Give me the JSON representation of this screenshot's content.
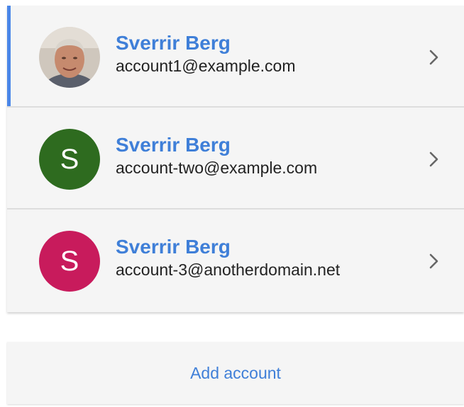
{
  "accounts": [
    {
      "name": "Sverrir Berg",
      "email": "account1@example.com",
      "avatar_type": "photo",
      "avatar_letter": "",
      "selected": true
    },
    {
      "name": "Sverrir Berg",
      "email": "account-two@example.com",
      "avatar_type": "letter",
      "avatar_letter": "S",
      "avatar_color": "#2e6b1f",
      "selected": false
    },
    {
      "name": "Sverrir Berg",
      "email": "account-3@anotherdomain.net",
      "avatar_type": "letter",
      "avatar_letter": "S",
      "avatar_color": "#c81b5c",
      "selected": false
    }
  ],
  "add_account": {
    "label": "Add account"
  },
  "colors": {
    "accent": "#4a86e8",
    "name_text": "#3f7fd8",
    "background": "#f5f5f5"
  },
  "icons": {
    "row_arrow": "chevron-right-icon"
  }
}
